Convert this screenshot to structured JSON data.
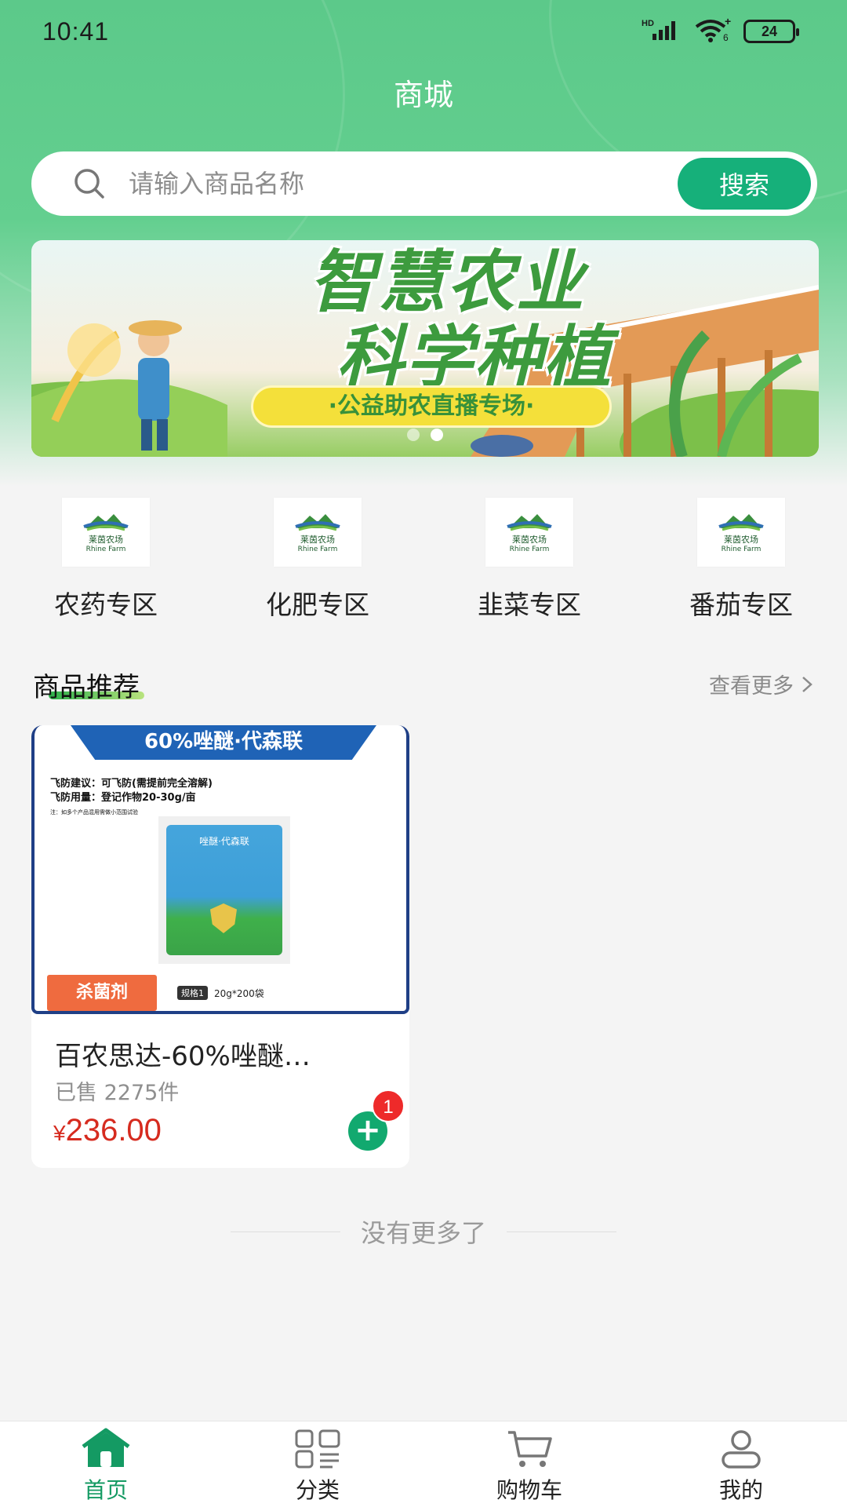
{
  "status_bar": {
    "time": "10:41",
    "network": "HD",
    "wifi_badge": "6",
    "battery": "24"
  },
  "header": {
    "title": "商城"
  },
  "search": {
    "placeholder": "请输入商品名称",
    "button_label": "搜索",
    "icon": "search-icon"
  },
  "banner": {
    "headline_line1": "智慧农业",
    "headline_line2": "科学种植",
    "subtitle": "·公益助农直播专场·",
    "slide_count": 2,
    "active_slide": 2
  },
  "categories": [
    {
      "label": "农药专区",
      "logo_cn": "莱茵农场",
      "logo_en": "Rhine Farm"
    },
    {
      "label": "化肥专区",
      "logo_cn": "莱茵农场",
      "logo_en": "Rhine Farm"
    },
    {
      "label": "韭菜专区",
      "logo_cn": "莱茵农场",
      "logo_en": "Rhine Farm"
    },
    {
      "label": "番茄专区",
      "logo_cn": "莱茵农场",
      "logo_en": "Rhine Farm"
    }
  ],
  "recommend": {
    "title": "商品推荐",
    "see_more": "查看更多"
  },
  "products": [
    {
      "image_banner": "60%唑醚·代森联",
      "image_note_1": "飞防建议：可飞防(需提前完全溶解)",
      "image_note_2": "飞防用量：登记作物20-30g/亩",
      "image_note_3": "注：如多个产品混用需做小范围试验",
      "pack_title": "唑醚·代森联",
      "tag": "杀菌剂",
      "spec_label": "规格1",
      "spec_value": "20g*200袋",
      "name": "百农思达-60%唑醚…",
      "sold": "已售 2275件",
      "currency": "¥",
      "price": "236.00",
      "cart_count": "1"
    }
  ],
  "footer": {
    "no_more": "没有更多了"
  },
  "tab_bar": [
    {
      "label": "首页",
      "icon": "home-icon",
      "active": true
    },
    {
      "label": "分类",
      "icon": "category-grid-icon",
      "active": false
    },
    {
      "label": "购物车",
      "icon": "cart-icon",
      "active": false
    },
    {
      "label": "我的",
      "icon": "user-icon",
      "active": false
    }
  ],
  "colors": {
    "brand_green": "#16b07a",
    "active_tab": "#149a63",
    "price_red": "#d62b1f",
    "tag_orange": "#ef6b3f"
  }
}
